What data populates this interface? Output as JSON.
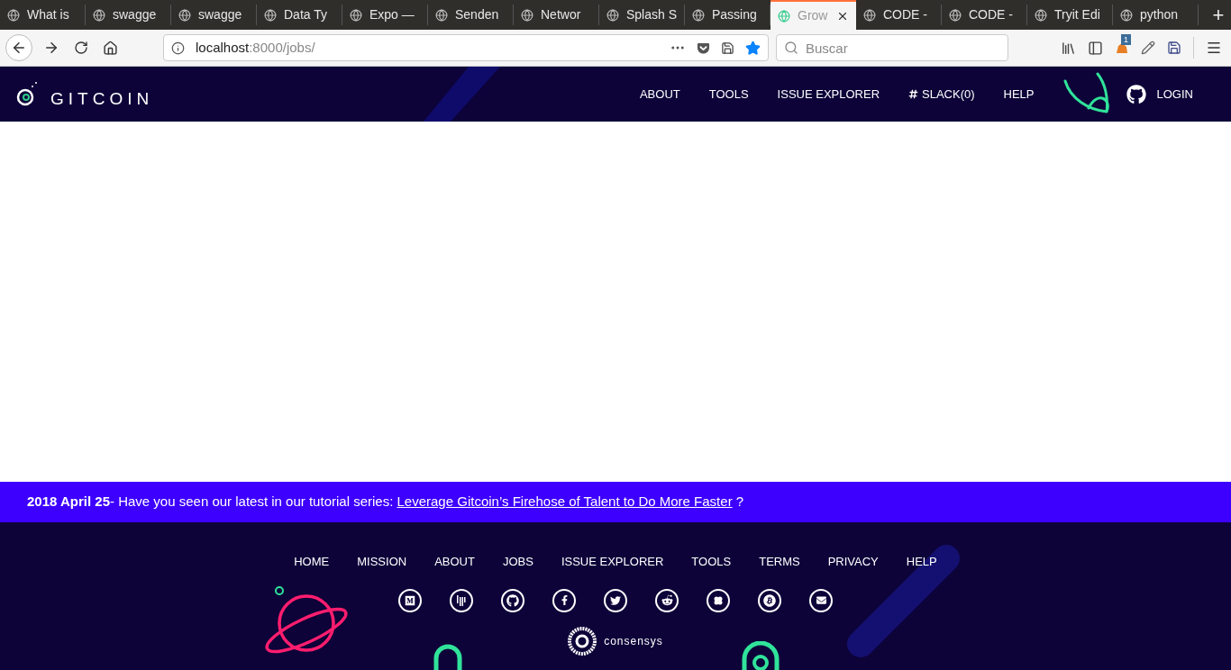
{
  "browser": {
    "tabs": [
      {
        "title": "What is",
        "selected": false
      },
      {
        "title": "swagge",
        "selected": false
      },
      {
        "title": "swagge",
        "selected": false
      },
      {
        "title": "Data Ty",
        "selected": false
      },
      {
        "title": "Expo —",
        "selected": false
      },
      {
        "title": "Senden",
        "selected": false
      },
      {
        "title": "Networ",
        "selected": false
      },
      {
        "title": "Splash S",
        "selected": false
      },
      {
        "title": "Passing",
        "selected": false
      },
      {
        "title": "Grow",
        "selected": true
      },
      {
        "title": "CODE -",
        "selected": false
      },
      {
        "title": "CODE -",
        "selected": false
      },
      {
        "title": "Tryit Edi",
        "selected": false
      },
      {
        "title": "python",
        "selected": false
      }
    ],
    "new_tab": "+",
    "url_host": "localhost",
    "url_path": ":8000/jobs/",
    "bookmarked": true,
    "search": {
      "placeholder": "Buscar"
    },
    "extension_badge": "1"
  },
  "header": {
    "logo": "GITCOIN",
    "nav": [
      "ABOUT",
      "TOOLS",
      "ISSUE EXPLORER",
      "SLACK(0)",
      "HELP"
    ],
    "login": "LOGIN"
  },
  "banner": {
    "text": "**2018 April 25**- Have you seen our latest in our tutorial series: ",
    "link": "Leverage Gitcoin’s Firehose of Talent to Do More Faster",
    "tail": " ?"
  },
  "footer": {
    "links": [
      "HOME",
      "MISSION",
      "ABOUT",
      "JOBS",
      "ISSUE EXPLORER",
      "TOOLS",
      "TERMS",
      "PRIVACY",
      "HELP"
    ],
    "social": [
      {
        "kind": "medium"
      },
      {
        "kind": "gitter"
      },
      {
        "kind": "github"
      },
      {
        "kind": "facebook"
      },
      {
        "kind": "twitter"
      },
      {
        "kind": "reddit"
      },
      {
        "kind": "clover"
      },
      {
        "kind": "bitcoin"
      },
      {
        "kind": "mail"
      }
    ],
    "sponsor": "consensys"
  }
}
